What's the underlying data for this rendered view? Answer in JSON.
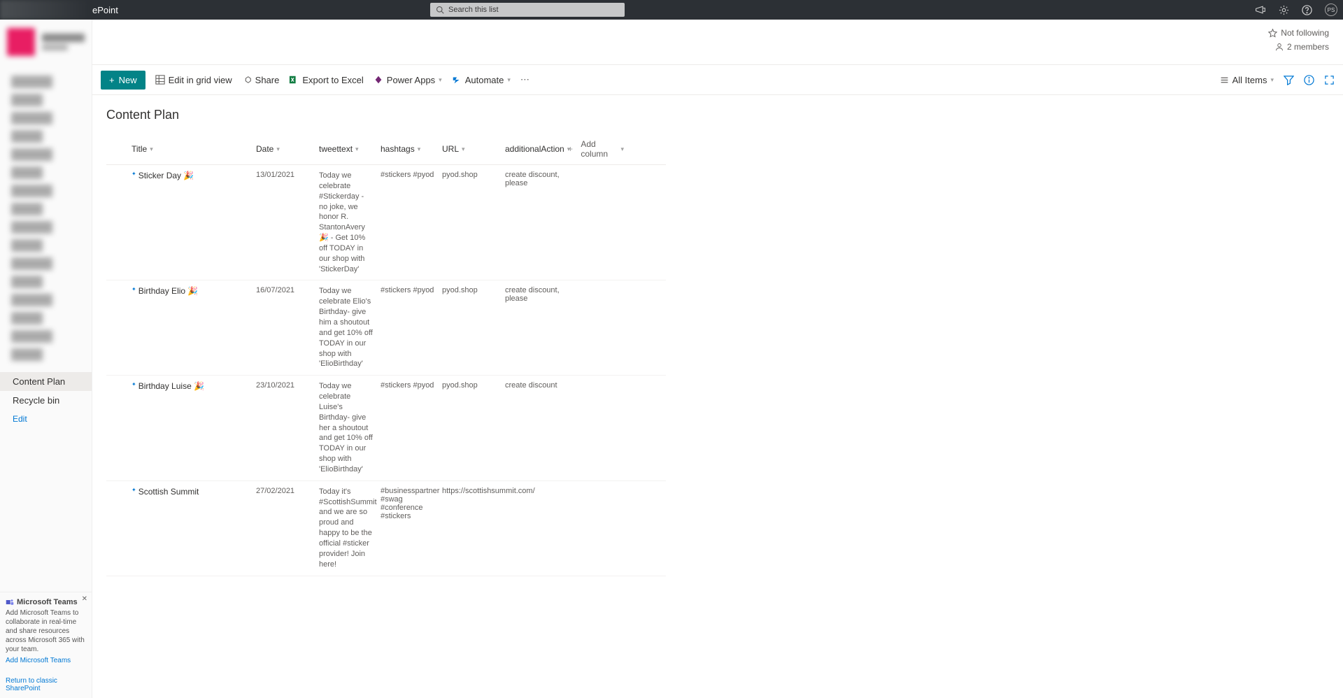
{
  "topbar": {
    "app_name": "ePoint",
    "search_placeholder": "Search this list",
    "avatar_initials": "PS"
  },
  "site_header": {
    "not_following": "Not following",
    "members": "2 members"
  },
  "sidebar": {
    "active_item": "Content Plan",
    "recycle": "Recycle bin",
    "edit": "Edit",
    "teams_title": "Microsoft Teams",
    "teams_desc": "Add Microsoft Teams to collaborate in real-time and share resources across Microsoft 365 with your team.",
    "teams_link": "Add Microsoft Teams",
    "return": "Return to classic SharePoint"
  },
  "commands": {
    "new": "New",
    "edit_grid": "Edit in grid view",
    "share": "Share",
    "export": "Export to Excel",
    "powerapps": "Power Apps",
    "automate": "Automate",
    "view": "All Items"
  },
  "list": {
    "title": "Content Plan",
    "columns": {
      "title": "Title",
      "date": "Date",
      "tweettext": "tweettext",
      "hashtags": "hashtags",
      "url": "URL",
      "additionalAction": "additionalAction",
      "add": "Add column"
    },
    "rows": [
      {
        "title": "Sticker Day 🎉",
        "date": "13/01/2021",
        "tweet": "Today we celebrate #Stickerday - no joke, we honor R. StantonAvery 🎉 - Get 10% off TODAY in our shop with 'StickerDay'",
        "hash": "#stickers #pyod",
        "url": "pyod.shop",
        "action": "create discount, please"
      },
      {
        "title": "Birthday Elio 🎉",
        "date": "16/07/2021",
        "tweet": "Today we celebrate Elio's Birthday- give him a shoutout and get 10% off TODAY in our shop with 'ElioBirthday'",
        "hash": "#stickers #pyod",
        "url": "pyod.shop",
        "action": "create discount, please"
      },
      {
        "title": "Birthday Luise 🎉",
        "date": "23/10/2021",
        "tweet": "Today we celebrate Luise's Birthday- give her a shoutout and get 10% off TODAY in our shop with 'ElioBirthday'",
        "hash": "#stickers #pyod",
        "url": "pyod.shop",
        "action": "create discount"
      },
      {
        "title": "Scottish Summit",
        "date": "27/02/2021",
        "tweet": "Today it's #ScottishSummit and we are so proud and happy to be the official #sticker provider! Join here!",
        "hash": "#businesspartner #swag #conference #stickers",
        "url": "https://scottishsummit.com/",
        "action": ""
      }
    ]
  }
}
